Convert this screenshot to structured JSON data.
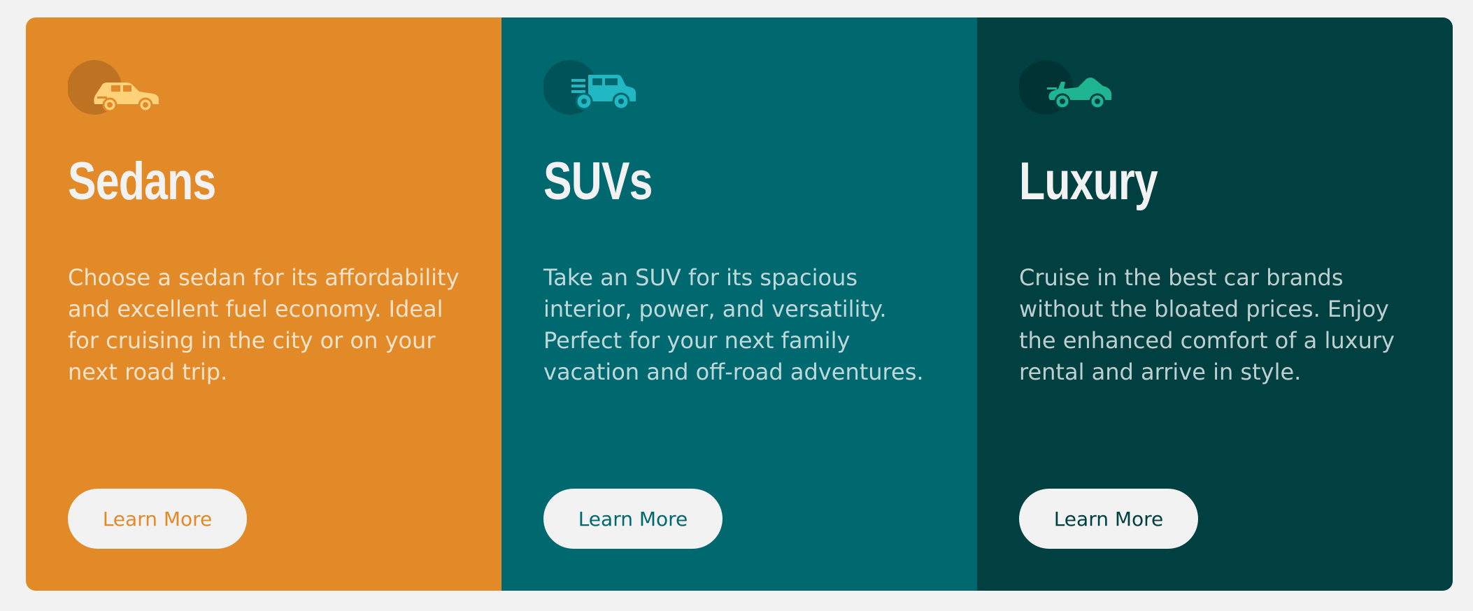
{
  "cards": [
    {
      "title": "Sedans",
      "description": "Choose a sedan for its affordability and excellent fuel economy. Ideal for cruising in the city or on your next road trip.",
      "button_label": "Learn More",
      "icon": "sedan-icon",
      "background": "#e28a28",
      "icon_color": "#ffd27a",
      "button_text_color": "#e28a28"
    },
    {
      "title": "SUVs",
      "description": "Take an SUV for its spacious interior, power, and versatility. Perfect for your next family vacation and off-road adventures.",
      "button_label": "Learn More",
      "icon": "suv-icon",
      "background": "#006970",
      "icon_color": "#22b8c3",
      "button_text_color": "#006970"
    },
    {
      "title": "Luxury",
      "description": "Cruise in the best car brands without the bloated prices. Enjoy the enhanced comfort of a luxury rental and arrive in style.",
      "button_label": "Learn More",
      "icon": "luxury-car-icon",
      "background": "#004041",
      "icon_color": "#1fb592",
      "button_text_color": "#004041"
    }
  ]
}
